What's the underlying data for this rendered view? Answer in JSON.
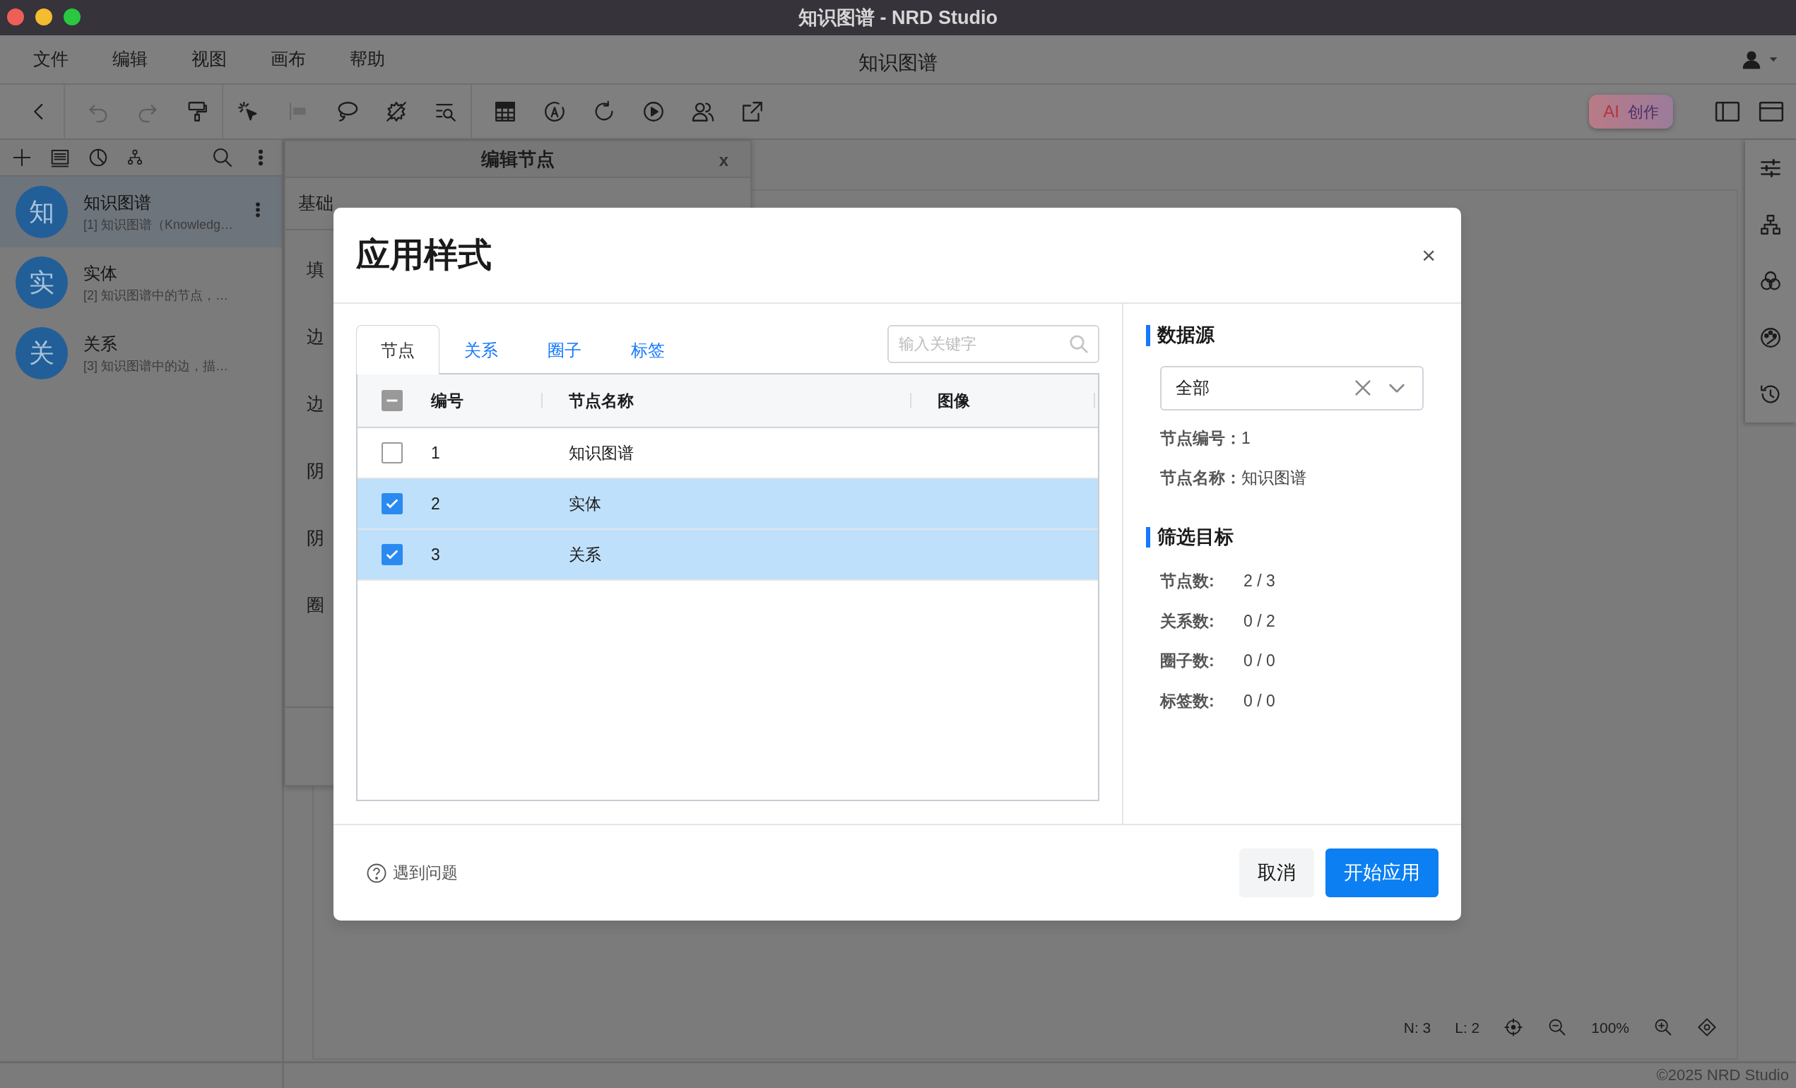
{
  "window": {
    "title": "知识图谱 - NRD Studio"
  },
  "menu": [
    "文件",
    "编辑",
    "视图",
    "画布",
    "帮助"
  ],
  "document_title": "知识图谱",
  "toolbar": {
    "ai_badge": "AI",
    "ai_label": "创作"
  },
  "sidebar": {
    "items": [
      {
        "avatar": "知",
        "title": "知识图谱",
        "subtitle": "[1] 知识图谱（Knowledg…",
        "selected": true
      },
      {
        "avatar": "实",
        "title": "实体",
        "subtitle": "[2] 知识图谱中的节点，…",
        "selected": false
      },
      {
        "avatar": "关",
        "title": "关系",
        "subtitle": "[3] 知识图谱中的边，描…",
        "selected": false
      }
    ]
  },
  "edit_panel": {
    "title": "编辑节点",
    "close": "x",
    "tab": "基础",
    "labels": [
      "填",
      "边",
      "边",
      "阴",
      "阴",
      "圈"
    ]
  },
  "modal": {
    "title": "应用样式",
    "close": "×",
    "tabs": [
      {
        "label": "节点",
        "selected": true
      },
      {
        "label": "关系",
        "selected": false
      },
      {
        "label": "圈子",
        "selected": false
      },
      {
        "label": "标签",
        "selected": false
      }
    ],
    "search": {
      "placeholder": "输入关键字"
    },
    "table": {
      "select_all": {
        "indeterminate": true
      },
      "columns": [
        "编号",
        "节点名称",
        "图像"
      ],
      "rows": [
        {
          "id": "1",
          "name": "知识图谱",
          "checked": false,
          "selected": false
        },
        {
          "id": "2",
          "name": "实体",
          "checked": true,
          "selected": true
        },
        {
          "id": "3",
          "name": "关系",
          "checked": true,
          "selected": true
        }
      ]
    },
    "data_source": {
      "heading": "数据源",
      "select_value": "全部",
      "fields": [
        {
          "label": "节点编号：",
          "value": "1"
        },
        {
          "label": "节点名称：",
          "value": "知识图谱"
        }
      ]
    },
    "filter": {
      "heading": "筛选目标",
      "stats": [
        {
          "label": "节点数:",
          "value": "2 / 3"
        },
        {
          "label": "关系数:",
          "value": "0 / 2"
        },
        {
          "label": "圈子数:",
          "value": "0 / 0"
        },
        {
          "label": "标签数:",
          "value": "0 / 0"
        }
      ]
    },
    "help_link": "遇到问题",
    "buttons": [
      {
        "label": "取消",
        "kind": "secondary"
      },
      {
        "label": "开始应用",
        "kind": "primary"
      }
    ]
  },
  "status": {
    "nodes": "N: 3",
    "links": "L: 2",
    "zoom": "100%"
  },
  "footer": "©2025 NRD Studio"
}
